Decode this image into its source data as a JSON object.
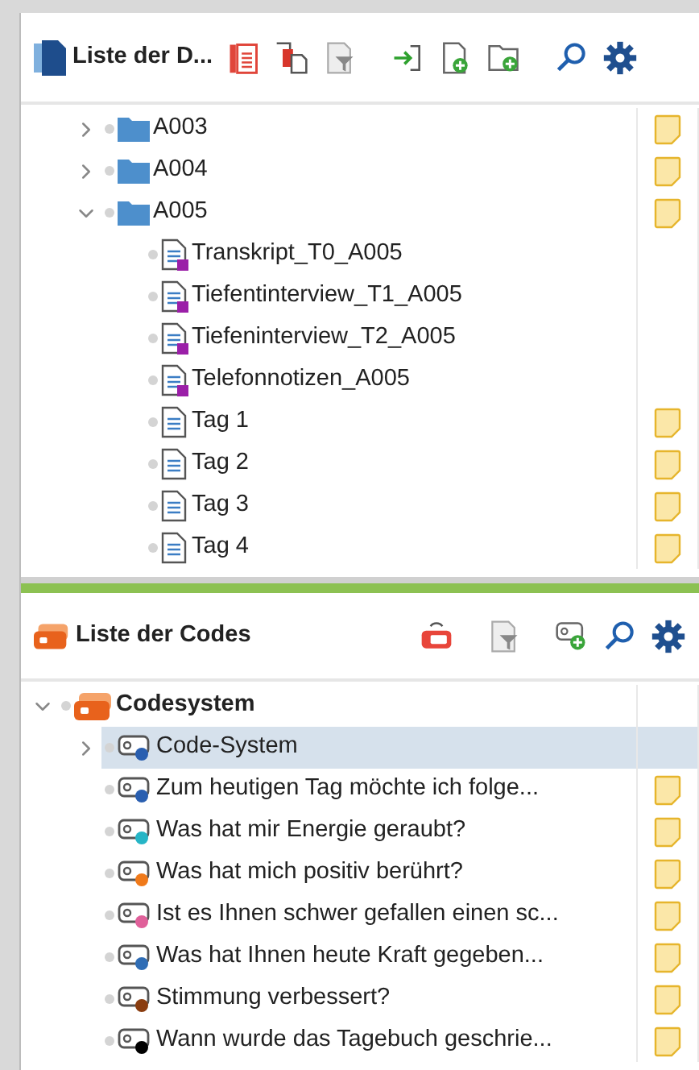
{
  "documents_panel": {
    "title": "Liste der D...",
    "tree": [
      {
        "kind": "folder",
        "label": "A003",
        "expanded": false,
        "memo": true
      },
      {
        "kind": "folder",
        "label": "A004",
        "expanded": false,
        "memo": true
      },
      {
        "kind": "folder",
        "label": "A005",
        "expanded": true,
        "memo": true,
        "children": [
          {
            "kind": "transcript",
            "label": "Transkript_T0_A005",
            "memo": false
          },
          {
            "kind": "transcript",
            "label": "Tiefentinterview_T1_A005",
            "memo": false
          },
          {
            "kind": "transcript",
            "label": "Tiefeninterview_T2_A005",
            "memo": false
          },
          {
            "kind": "transcript",
            "label": "Telefonnotizen_A005",
            "memo": false
          },
          {
            "kind": "text",
            "label": "Tag 1",
            "memo": true
          },
          {
            "kind": "text",
            "label": "Tag 2",
            "memo": true
          },
          {
            "kind": "text",
            "label": "Tag 3",
            "memo": true
          },
          {
            "kind": "text",
            "label": "Tag 4",
            "memo": true
          }
        ]
      }
    ]
  },
  "codes_panel": {
    "title": "Liste der Codes",
    "tree": [
      {
        "kind": "root",
        "label": "Codesystem",
        "expanded": true,
        "memo": false,
        "selected": false,
        "children": [
          {
            "kind": "code",
            "label": "Code-System",
            "color": "#2a5fb0",
            "expanded": false,
            "memo": false,
            "selected": true
          },
          {
            "kind": "code",
            "label": "Zum heutigen Tag möchte ich folge...",
            "color": "#2a5fb0",
            "memo": true,
            "selected": false
          },
          {
            "kind": "code",
            "label": "Was hat mir Energie geraubt?",
            "color": "#26b5c6",
            "memo": true,
            "selected": false
          },
          {
            "kind": "code",
            "label": "Was hat mich positiv berührt?",
            "color": "#f07a1a",
            "memo": true,
            "selected": false
          },
          {
            "kind": "code",
            "label": "Ist es Ihnen schwer gefallen einen sc...",
            "color": "#e0609a",
            "memo": true,
            "selected": false
          },
          {
            "kind": "code",
            "label": "Was hat Ihnen heute Kraft gegeben...",
            "color": "#2f6db5",
            "memo": true,
            "selected": false
          },
          {
            "kind": "code",
            "label": "Stimmung verbessert?",
            "color": "#8a3d10",
            "memo": true,
            "selected": false
          },
          {
            "kind": "code",
            "label": "Wann wurde das Tagebuch geschrie...",
            "color": "#000000",
            "memo": true,
            "selected": false
          }
        ]
      }
    ]
  }
}
